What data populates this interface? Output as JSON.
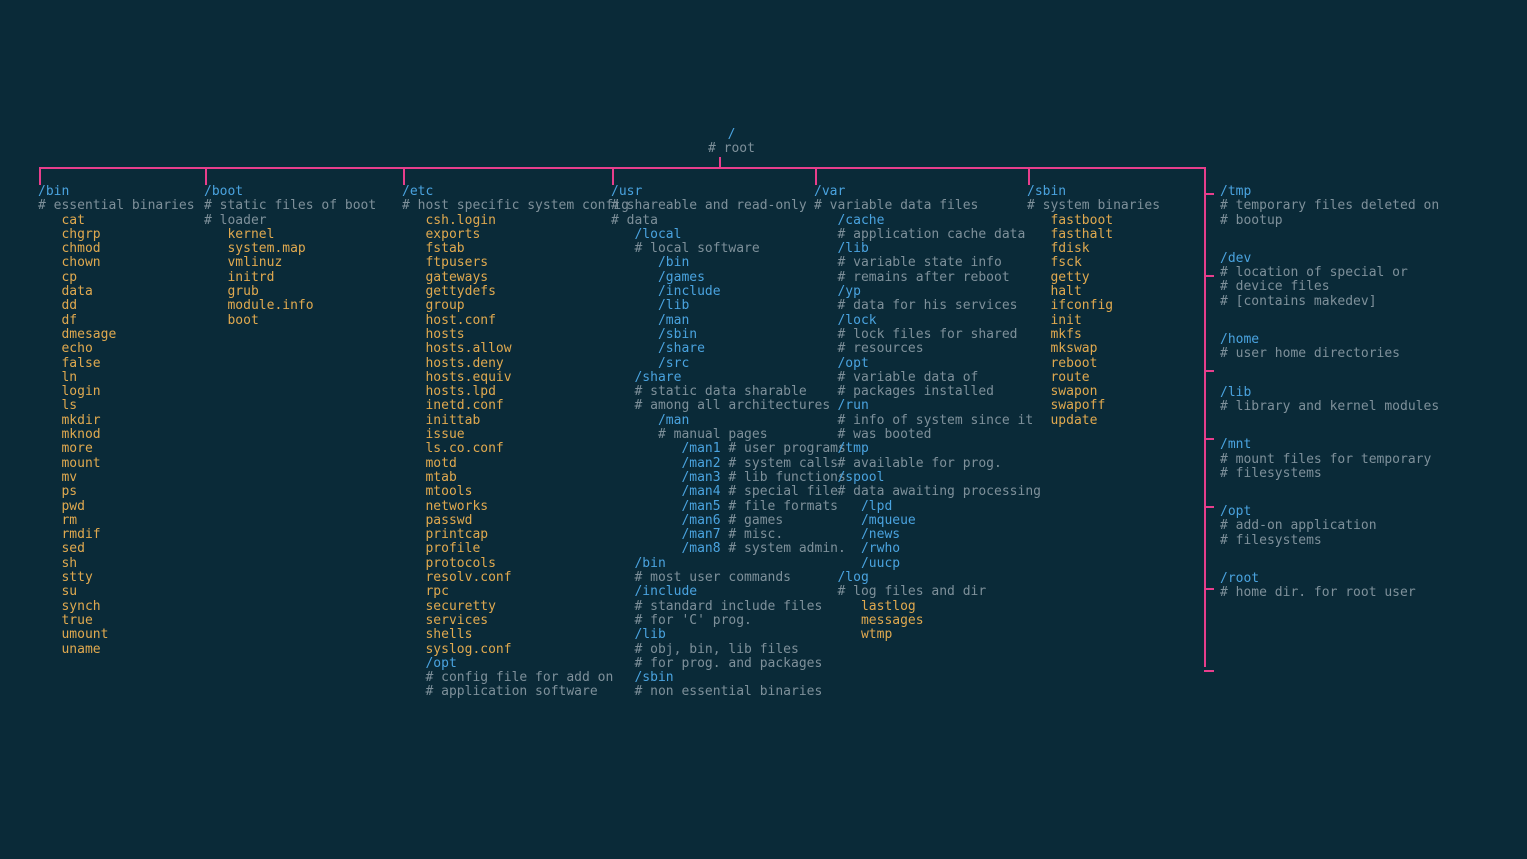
{
  "root": {
    "path": "/",
    "comment": "# root"
  },
  "colors": {
    "bg": "#0a2a38",
    "blue": "#4aa3df",
    "orange": "#e0a94f",
    "comment": "#7e909a",
    "pink": "#e83e8c"
  },
  "branches": {
    "bin": {
      "path": "/bin",
      "comment": "# essential binaries",
      "items": [
        "cat",
        "chgrp",
        "chmod",
        "chown",
        "cp",
        "data",
        "dd",
        "df",
        "dmesage",
        "echo",
        "false",
        "ln",
        "login",
        "ls",
        "mkdir",
        "mknod",
        "more",
        "mount",
        "mv",
        "ps",
        "pwd",
        "rm",
        "rmdif",
        "sed",
        "sh",
        "stty",
        "su",
        "synch",
        "true",
        "umount",
        "uname"
      ]
    },
    "boot": {
      "path": "/boot",
      "comment": "# static files of boot",
      "first": "# loader",
      "items": [
        "kernel",
        "system.map",
        "vmlinuz",
        "initrd",
        "grub",
        "module.info",
        "boot"
      ]
    },
    "etc": {
      "path": "/etc",
      "comment": "# host specific system config",
      "items": [
        "csh.login",
        "exports",
        "fstab",
        "ftpusers",
        "gateways",
        "gettydefs",
        "group",
        "host.conf",
        "hosts",
        "hosts.allow",
        "hosts.deny",
        "hosts.equiv",
        "hosts.lpd",
        "inetd.conf",
        "inittab",
        "issue",
        "ls.co.conf",
        "motd",
        "mtab",
        "mtools",
        "networks",
        "passwd",
        "printcap",
        "profile",
        "protocols",
        "resolv.conf",
        "rpc",
        "securetty",
        "services",
        "shells",
        "syslog.conf"
      ],
      "sub": {
        "path": "/opt",
        "comments": [
          "# config file for add on",
          "# application software"
        ]
      }
    },
    "usr": {
      "path": "/usr",
      "comment": "# shareable and read-only",
      "first": "# data",
      "tree": [
        {
          "t": "dir",
          "name": "/local",
          "comment": "# local software",
          "children": [
            "/bin",
            "/games",
            "/include",
            "/lib",
            "/man",
            "/sbin",
            "/share",
            "/src"
          ]
        },
        {
          "t": "dir",
          "name": "/share",
          "comments": [
            "# static data sharable",
            "# among all architectures"
          ],
          "children": [
            {
              "t": "dir",
              "name": "/man",
              "comment": "# manual pages",
              "children": [
                {
                  "name": "/man1",
                  "c": "# user programs"
                },
                {
                  "name": "/man2",
                  "c": "# system calls"
                },
                {
                  "name": "/man3",
                  "c": "# lib functions"
                },
                {
                  "name": "/man4",
                  "c": "# special file"
                },
                {
                  "name": "/man5",
                  "c": "# file formats"
                },
                {
                  "name": "/man6",
                  "c": "# games"
                },
                {
                  "name": "/man7",
                  "c": "# misc."
                },
                {
                  "name": "/man8",
                  "c": "# system admin."
                }
              ]
            }
          ]
        },
        {
          "t": "dir",
          "name": "/bin",
          "comments": [
            "# most user commands"
          ]
        },
        {
          "t": "dir",
          "name": "/include",
          "comments": [
            "# standard include files",
            "# for 'C' prog."
          ]
        },
        {
          "t": "dir",
          "name": "/lib",
          "comments": [
            "# obj, bin, lib files",
            "# for prog. and packages"
          ]
        },
        {
          "t": "dir",
          "name": "/sbin",
          "comments": [
            "# non essential binaries"
          ]
        }
      ]
    },
    "var": {
      "path": "/var",
      "comment": "# variable data files",
      "tree": [
        {
          "name": "/cache",
          "comments": [
            "# application cache data"
          ]
        },
        {
          "name": "/lib",
          "comments": [
            "# variable state info",
            "# remains after reboot"
          ]
        },
        {
          "name": "/yp",
          "comments": [
            "# data for his services"
          ]
        },
        {
          "name": "/lock",
          "comments": [
            "# lock files for shared",
            "# resources"
          ]
        },
        {
          "name": "/opt",
          "comments": [
            "# variable data of",
            "# packages installed"
          ]
        },
        {
          "name": "/run",
          "comments": [
            "# info of system since it",
            "# was booted"
          ]
        },
        {
          "name": "/tmp",
          "comments": [
            "# available for prog."
          ]
        },
        {
          "name": "/spool",
          "comments": [
            "# data awaiting processing"
          ],
          "children": [
            "/lpd",
            "/mqueue",
            "/news",
            "/rwho",
            "/uucp"
          ]
        },
        {
          "name": "/log",
          "comments": [
            "# log files and dir"
          ],
          "items": [
            "lastlog",
            "messages",
            "wtmp"
          ]
        }
      ]
    },
    "sbin": {
      "path": "/sbin",
      "comment": "# system binaries",
      "items": [
        "fastboot",
        "fasthalt",
        "fdisk",
        "fsck",
        "getty",
        "halt",
        "ifconfig",
        "init",
        "mkfs",
        "mkswap",
        "reboot",
        "route",
        "swapon",
        "swapoff",
        "update"
      ]
    },
    "right": [
      {
        "path": "/tmp",
        "comments": [
          "# temporary files deleted on",
          "# bootup"
        ]
      },
      {
        "path": "/dev",
        "comments": [
          "# location of special or",
          "# device files",
          "# [contains makedev]"
        ]
      },
      {
        "path": "/home",
        "comments": [
          "# user home directories"
        ]
      },
      {
        "path": "/lib",
        "comments": [
          "# library and kernel modules"
        ]
      },
      {
        "path": "/mnt",
        "comments": [
          "# mount files for temporary",
          "# filesystems"
        ]
      },
      {
        "path": "/opt",
        "comments": [
          "# add-on application",
          "# filesystems"
        ]
      },
      {
        "path": "/root",
        "comments": [
          "# home dir. for root user"
        ]
      }
    ]
  }
}
